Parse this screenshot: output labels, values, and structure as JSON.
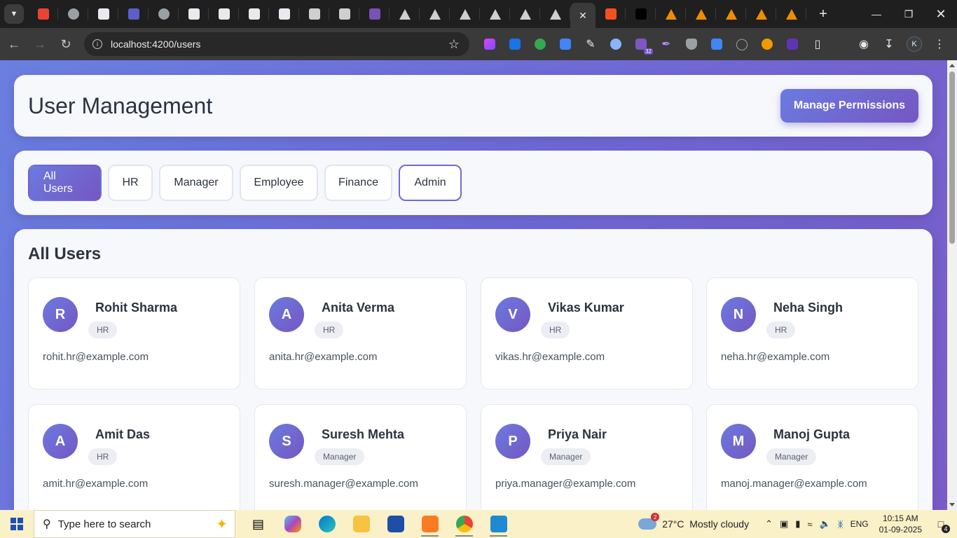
{
  "browser": {
    "url": "localhost:4200/users",
    "tabs": [
      {
        "icon": "chevron-down-icon"
      },
      {
        "icon": "gmail-icon",
        "color": "#ea4335"
      },
      {
        "icon": "globe-icon",
        "color": "#9aa0a6"
      },
      {
        "icon": "infinity-icon",
        "color": "#e8eaed"
      },
      {
        "icon": "teams-icon",
        "color": "#5b5fc7"
      },
      {
        "icon": "globe-icon",
        "color": "#9aa0a6"
      },
      {
        "icon": "chatgpt-icon",
        "color": "#e8eaed"
      },
      {
        "icon": "sparkle-icon",
        "color": "#e8eaed"
      },
      {
        "icon": "bot-icon",
        "color": "#e8eaed"
      },
      {
        "icon": "script-icon",
        "color": "#e8eaed"
      },
      {
        "icon": "xampp-icon",
        "color": "#cfcfcf"
      },
      {
        "icon": "xampp-icon",
        "color": "#cfcfcf"
      },
      {
        "icon": "bootstrap-icon",
        "color": "#7952b3"
      },
      {
        "icon": "angular-icon",
        "color": "#cfcfcf"
      },
      {
        "icon": "angular-icon",
        "color": "#cfcfcf"
      },
      {
        "icon": "angular-icon",
        "color": "#cfcfcf"
      },
      {
        "icon": "angular-icon",
        "color": "#cfcfcf"
      },
      {
        "icon": "angular-icon",
        "color": "#cfcfcf"
      },
      {
        "icon": "angular-icon",
        "color": "#cfcfcf"
      }
    ],
    "tabs_after": [
      {
        "icon": "xampp-icon",
        "color": "#f4511e"
      },
      {
        "icon": "dark-app-icon",
        "color": "#000000"
      },
      {
        "icon": "angular-icon",
        "color": "#f08c00"
      },
      {
        "icon": "angular-icon",
        "color": "#f08c00"
      },
      {
        "icon": "angular-icon",
        "color": "#f08c00"
      },
      {
        "icon": "angular-icon",
        "color": "#f08c00"
      },
      {
        "icon": "angular-icon",
        "color": "#f08c00"
      }
    ],
    "profile_initial": "K",
    "extension_badge": "32"
  },
  "page": {
    "title": "User Management",
    "manage_btn": "Manage Permissions",
    "filters": [
      "All Users",
      "HR",
      "Manager",
      "Employee",
      "Finance",
      "Admin"
    ],
    "section_title": "All Users",
    "users": [
      {
        "initial": "R",
        "name": "Rohit Sharma",
        "role": "HR",
        "email": "rohit.hr@example.com"
      },
      {
        "initial": "A",
        "name": "Anita Verma",
        "role": "HR",
        "email": "anita.hr@example.com"
      },
      {
        "initial": "V",
        "name": "Vikas Kumar",
        "role": "HR",
        "email": "vikas.hr@example.com"
      },
      {
        "initial": "N",
        "name": "Neha Singh",
        "role": "HR",
        "email": "neha.hr@example.com"
      },
      {
        "initial": "A",
        "name": "Amit Das",
        "role": "HR",
        "email": "amit.hr@example.com"
      },
      {
        "initial": "S",
        "name": "Suresh Mehta",
        "role": "Manager",
        "email": "suresh.manager@example.com"
      },
      {
        "initial": "P",
        "name": "Priya Nair",
        "role": "Manager",
        "email": "priya.manager@example.com"
      },
      {
        "initial": "M",
        "name": "Manoj Gupta",
        "role": "Manager",
        "email": "manoj.manager@example.com"
      }
    ]
  },
  "taskbar": {
    "search_placeholder": "Type here to search",
    "weather_temp": "27°C",
    "weather_text": "Mostly cloudy",
    "weather_badge": "2",
    "language": "ENG",
    "time": "10:15 AM",
    "date": "01-09-2025",
    "notification_count": "4"
  },
  "colors": {
    "accent_start": "#6a7be0",
    "accent_end": "#7656c2",
    "background": "#6f6ad6"
  }
}
